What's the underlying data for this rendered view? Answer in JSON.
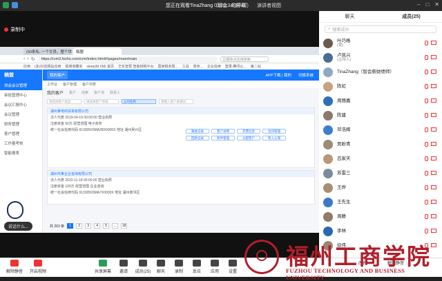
{
  "topbar": {
    "viewing_text": "您正在观看TinaZhang（智会...的屏幕",
    "timer": "01:02:34(3小时)",
    "speaker_view": "演讲者视图"
  },
  "recording_label": "录制中",
  "browser": {
    "tabs": [
      "(50条私..一个文员，整个世界",
      "稿盟"
    ],
    "url": "https://crm2.fzzhs.com/crm/index.html#/pages/main/main",
    "search_placeholder": "近期热点应用搜索",
    "bookmarks": [
      "应用",
      "(多)抖音网站应用",
      "极简收藏夹",
      "sleep(M.XM) 首页",
      "华东智慧 智能财税平台",
      "国家税务局...",
      "工具",
      "政务...",
      "企业信用",
      "登录-腾讯公...",
      "第二站"
    ]
  },
  "app": {
    "logo": "稿盟",
    "sidebar": [
      "领会会议管理",
      "审批管理中心",
      "会议汇报中心",
      "会议管理",
      "财务管理",
      "客户管理",
      "工作量考核",
      "智能报表"
    ],
    "header_tabs": [
      "我的客户"
    ],
    "header_right": [
      "APP下载 | 我的",
      "切换系统"
    ],
    "crumbs": [
      "工作台",
      "客户管理",
      "客户列表"
    ],
    "page_title": "我的客户",
    "sub_tabs": [
      "客户",
      "线索",
      "客户池",
      "联系人"
    ],
    "filters": [
      "请选择客户类型",
      "请选择客户等级",
      "公司名称",
      "请输入客户关键词"
    ],
    "records": [
      {
        "title": "湖州某电商贸易有限公司",
        "line1": "法人代表  2019-04-19 00:00:00  营业执照",
        "line2": "注册资金  50万  经营范围  电子商务",
        "line3": "统一社会信用代码  91330503MA28X0000X  地址  湖州吴兴区"
      },
      {
        "title": "湖州市某企业咨询有限公司",
        "line1": "法人代表  2022-11-18 00:00:00  营业执照",
        "line2": "注册资金  100万  经营范围  企业咨询",
        "line3": "统一社会信用代码  91330503MA7X0000X  地址  湖州南浔区"
      }
    ],
    "tags": [
      "跟进记录",
      "客户详情",
      "开票信息",
      "合同管理",
      "回款记录",
      "附件管理",
      "分配客户",
      "移入公海"
    ],
    "pager": {
      "total": "共 263 条",
      "pages": [
        "1",
        "2",
        "3",
        "4",
        "5",
        "...",
        "18"
      ],
      "current": "1"
    }
  },
  "caption_bubble": "说话什么...",
  "panel": {
    "tabs": [
      "聊天",
      "成员(25)"
    ],
    "search_placeholder": "搜索成员",
    "members": [
      {
        "name": "叶巧格",
        "role": "(我)",
        "color": "#6b5a4e"
      },
      {
        "name": "卢凯兴",
        "role": "(主持人)",
        "color": "#4a6d92"
      },
      {
        "name": "TinaZhang（智会薪财绩师）",
        "role": "",
        "color": "#8fa8c4"
      },
      {
        "name": "陈虹",
        "role": "",
        "color": "#c7a27c"
      },
      {
        "name": "周丽嘉",
        "role": "",
        "color": "#2f6fb8"
      },
      {
        "name": "陈建",
        "role": "",
        "color": "#8a7a6a"
      },
      {
        "name": "邓浩辉",
        "role": "",
        "color": "#3c7fd0"
      },
      {
        "name": "贾盼青",
        "role": "",
        "color": "#9a8a78"
      },
      {
        "name": "吕家天",
        "role": "",
        "color": "#b8967a"
      },
      {
        "name": "苏雷三",
        "role": "",
        "color": "#7a8a9a"
      },
      {
        "name": "王烨",
        "role": "",
        "color": "#a78e74"
      },
      {
        "name": "王先生",
        "role": "",
        "color": "#3b78c6"
      },
      {
        "name": "周静",
        "role": "",
        "color": "#8e7b6a"
      },
      {
        "name": "李林",
        "role": "",
        "color": "#2d66b0"
      },
      {
        "name": "徐伟",
        "role": "",
        "color": "#9c8572"
      }
    ]
  },
  "toolbar": {
    "buttons": [
      "解除静音",
      "开启视频",
      "共享屏幕",
      "邀请",
      "成员(25)",
      "聊天",
      "录制",
      "反应",
      "应用",
      "设置",
      "改名",
      "解除静音"
    ]
  },
  "watermark": {
    "cn": "福州工商学院",
    "en": "FUZHOU TECHNOLOGY AND BUSINESS UNIVERSITY"
  },
  "colors": {
    "accent": "#1677ff",
    "recording": "#ee3333",
    "watermark": "#b11e2b"
  }
}
